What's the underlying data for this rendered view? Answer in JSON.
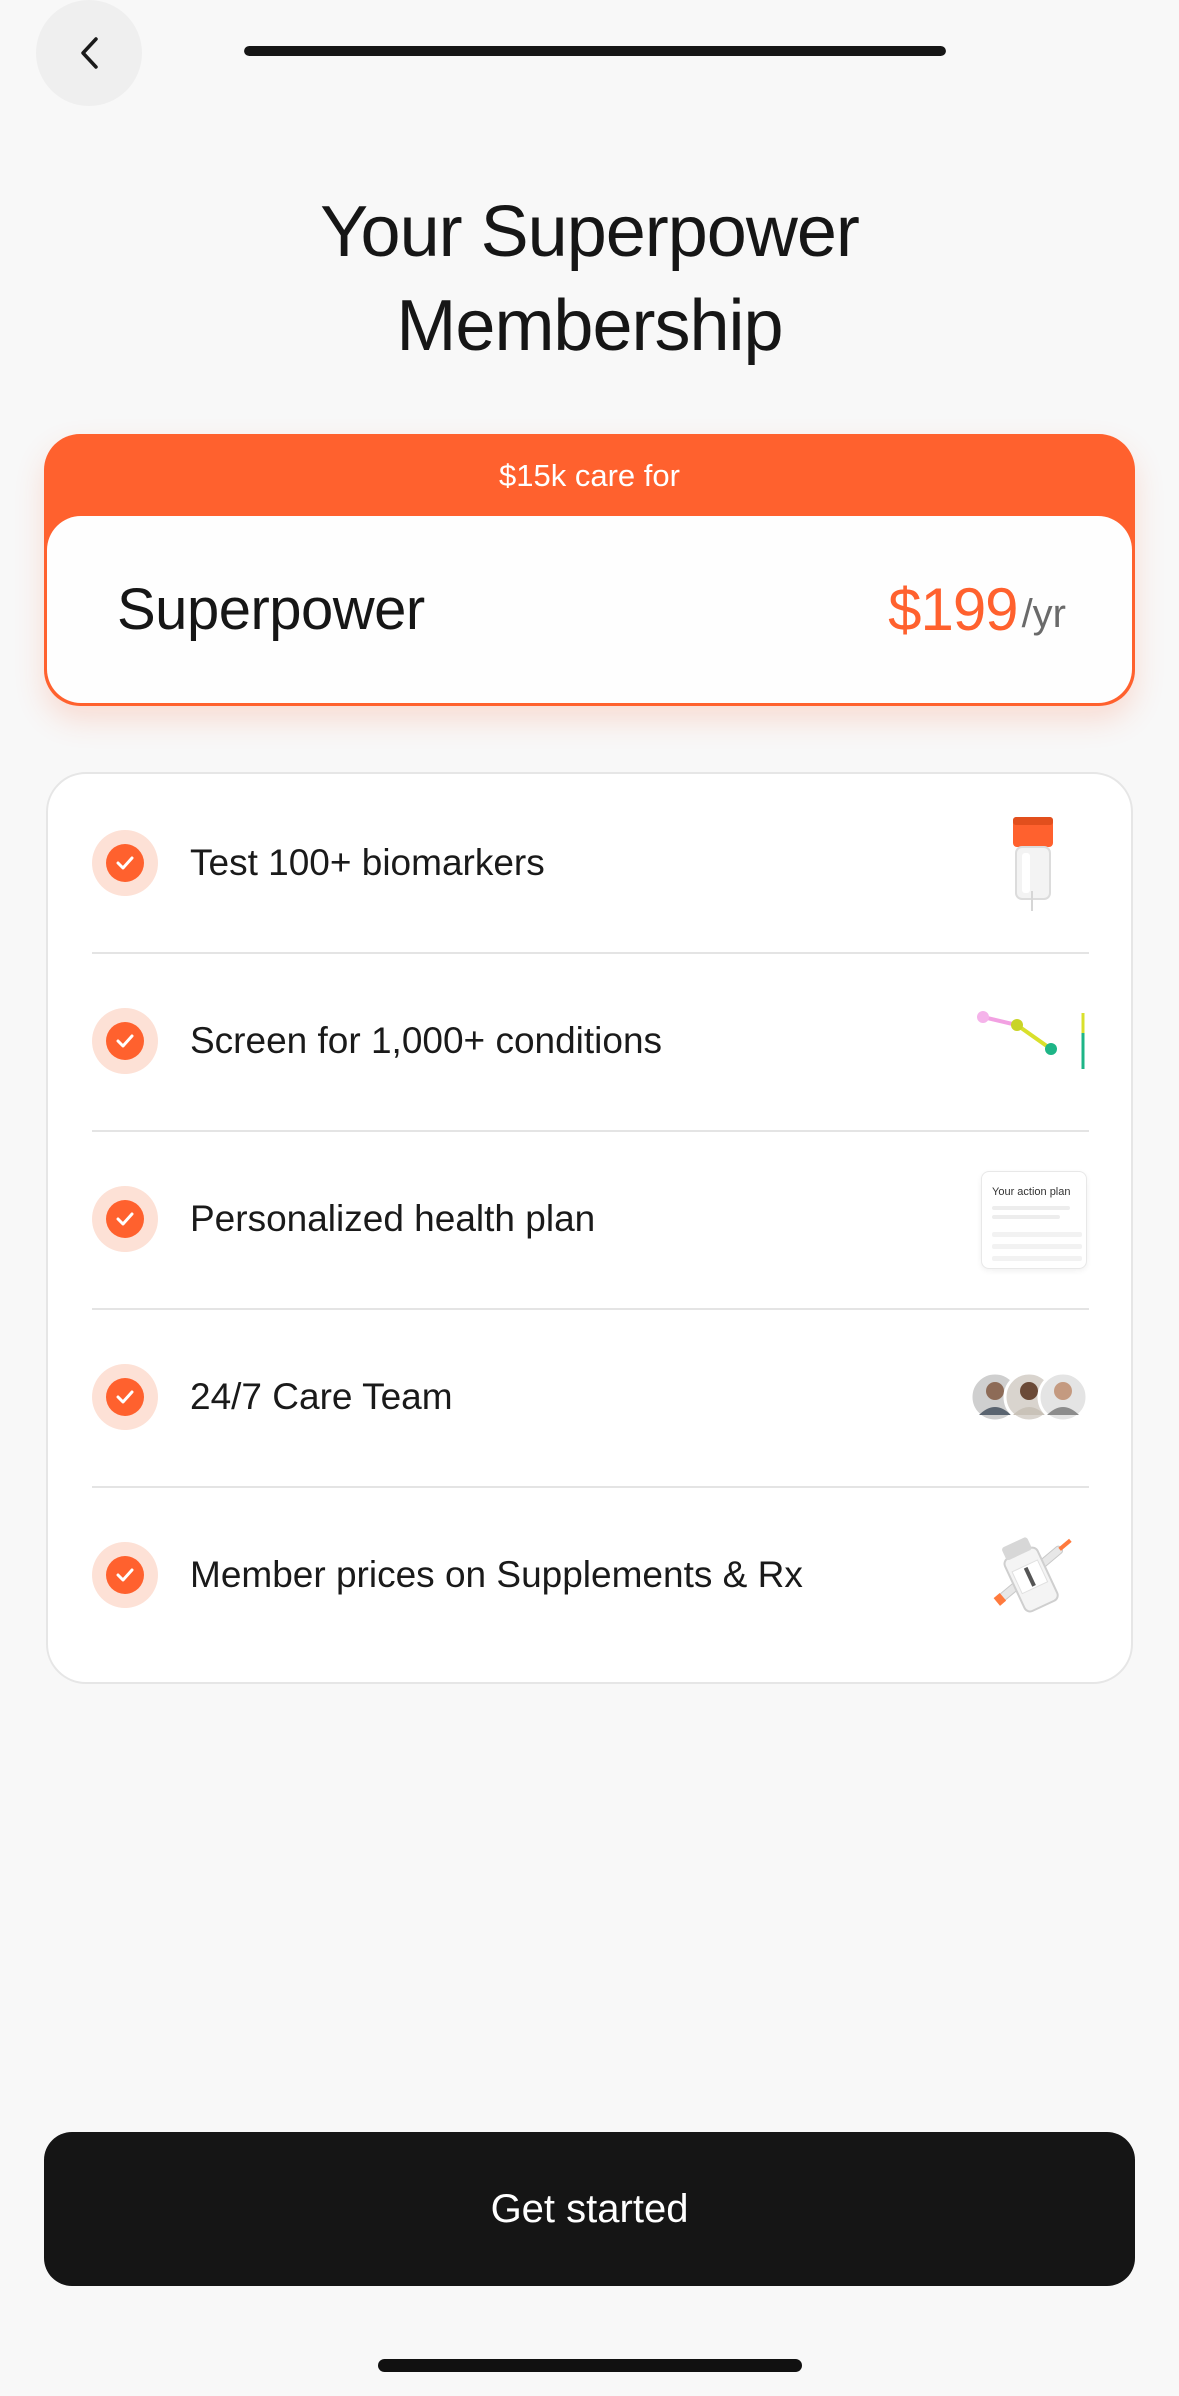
{
  "header": {
    "progress_fraction": 1.0
  },
  "title": {
    "line1": "Your Superpower",
    "line2": "Membership"
  },
  "plan": {
    "banner": "$15k care for",
    "name": "Superpower",
    "price": "$199",
    "period": "/yr"
  },
  "features": [
    {
      "label": "Test 100+ biomarkers",
      "icon": "blood-tube-icon"
    },
    {
      "label": "Screen for 1,000+ conditions",
      "icon": "condition-graph-icon"
    },
    {
      "label": "Personalized health plan",
      "icon": "action-plan-icon",
      "thumb_text": "Your action plan"
    },
    {
      "label": "24/7 Care Team",
      "icon": "care-team-avatars-icon"
    },
    {
      "label": "Member prices on Supplements & Rx",
      "icon": "vial-syringe-icon"
    }
  ],
  "cta": {
    "label": "Get started"
  },
  "colors": {
    "accent": "#ff612e",
    "accent_tint": "#fde1d6",
    "dark": "#151515",
    "background": "#f8f8f8"
  }
}
